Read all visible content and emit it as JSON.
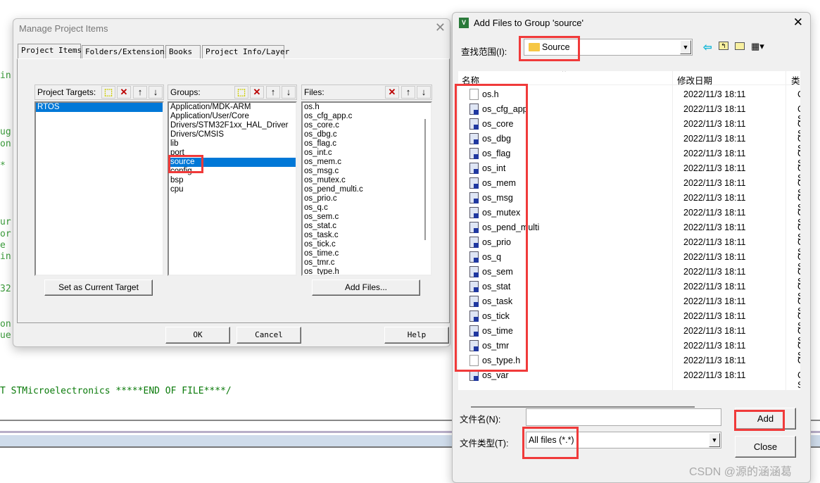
{
  "background_code": {
    "fragments": [
      "in",
      "ug",
      "on",
      "*",
      "ur",
      "or",
      "e",
      "in",
      "32",
      "on",
      "ue"
    ],
    "end_line": "T STMicroelectronics *****END OF FILE****/"
  },
  "manage_dialog": {
    "title": "Manage Project Items",
    "tabs": [
      "Project Items",
      "Folders/Extensions",
      "Books",
      "Project Info/Layer"
    ],
    "targets": {
      "label": "Project Targets:",
      "items": [
        "RTOS"
      ],
      "selected": "RTOS"
    },
    "groups": {
      "label": "Groups:",
      "items": [
        "Application/MDK-ARM",
        "Application/User/Core",
        "Drivers/STM32F1xx_HAL_Driver",
        "Drivers/CMSIS",
        "lib",
        "port",
        "source",
        "config",
        "bsp",
        "cpu"
      ],
      "selected": "source"
    },
    "files": {
      "label": "Files:",
      "items": [
        "os.h",
        "os_cfg_app.c",
        "os_core.c",
        "os_dbg.c",
        "os_flag.c",
        "os_int.c",
        "os_mem.c",
        "os_msg.c",
        "os_mutex.c",
        "os_pend_multi.c",
        "os_prio.c",
        "os_q.c",
        "os_sem.c",
        "os_stat.c",
        "os_task.c",
        "os_tick.c",
        "os_time.c",
        "os_tmr.c",
        "os_type.h"
      ]
    },
    "set_target_button": "Set as Current Target",
    "add_files_button": "Add Files...",
    "ok_button": "OK",
    "cancel_button": "Cancel",
    "help_button": "Help"
  },
  "add_dialog": {
    "title": "Add Files to Group 'source'",
    "look_in_label": "查找范围(I):",
    "look_in_value": "Source",
    "columns": {
      "name": "名称",
      "date": "修改日期",
      "type": "类"
    },
    "files": [
      {
        "name": "os.h",
        "date": "2022/11/3 18:11",
        "type": "C/",
        "kind": "h"
      },
      {
        "name": "os_cfg_app",
        "date": "2022/11/3 18:11",
        "type": "C S",
        "kind": "c"
      },
      {
        "name": "os_core",
        "date": "2022/11/3 18:11",
        "type": "C S",
        "kind": "c"
      },
      {
        "name": "os_dbg",
        "date": "2022/11/3 18:11",
        "type": "C S",
        "kind": "c"
      },
      {
        "name": "os_flag",
        "date": "2022/11/3 18:11",
        "type": "C S",
        "kind": "c"
      },
      {
        "name": "os_int",
        "date": "2022/11/3 18:11",
        "type": "C S",
        "kind": "c"
      },
      {
        "name": "os_mem",
        "date": "2022/11/3 18:11",
        "type": "C S",
        "kind": "c"
      },
      {
        "name": "os_msg",
        "date": "2022/11/3 18:11",
        "type": "C S",
        "kind": "c"
      },
      {
        "name": "os_mutex",
        "date": "2022/11/3 18:11",
        "type": "C S",
        "kind": "c"
      },
      {
        "name": "os_pend_multi",
        "date": "2022/11/3 18:11",
        "type": "C S",
        "kind": "c"
      },
      {
        "name": "os_prio",
        "date": "2022/11/3 18:11",
        "type": "C S",
        "kind": "c"
      },
      {
        "name": "os_q",
        "date": "2022/11/3 18:11",
        "type": "C S",
        "kind": "c"
      },
      {
        "name": "os_sem",
        "date": "2022/11/3 18:11",
        "type": "C S",
        "kind": "c"
      },
      {
        "name": "os_stat",
        "date": "2022/11/3 18:11",
        "type": "C S",
        "kind": "c"
      },
      {
        "name": "os_task",
        "date": "2022/11/3 18:11",
        "type": "C S",
        "kind": "c"
      },
      {
        "name": "os_tick",
        "date": "2022/11/3 18:11",
        "type": "C S",
        "kind": "c"
      },
      {
        "name": "os_time",
        "date": "2022/11/3 18:11",
        "type": "C S",
        "kind": "c"
      },
      {
        "name": "os_tmr",
        "date": "2022/11/3 18:11",
        "type": "C S",
        "kind": "c"
      },
      {
        "name": "os_type.h",
        "date": "2022/11/3 18:11",
        "type": "C/",
        "kind": "h"
      },
      {
        "name": "os_var",
        "date": "2022/11/3 18:11",
        "type": "C S",
        "kind": "c"
      }
    ],
    "filename_label": "文件名(N):",
    "filename_value": "",
    "filetype_label": "文件类型(T):",
    "filetype_value": "All files (*.*)",
    "add_button": "Add",
    "close_button": "Close"
  },
  "watermark": "CSDN @源的涵涵葛",
  "colors": {
    "selection": "#0078d7",
    "highlight_box": "#f03a3a",
    "code_green": "#3a9a3a"
  }
}
